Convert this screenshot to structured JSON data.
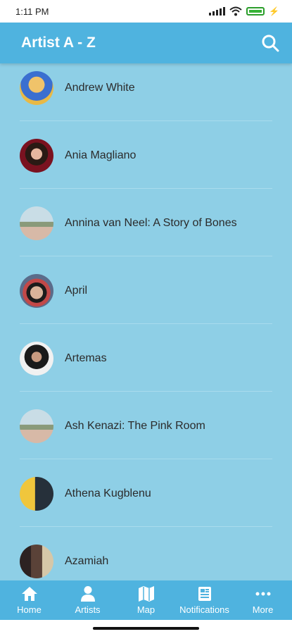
{
  "status_bar": {
    "time": "1:11 PM"
  },
  "app_bar": {
    "title": "Artist A - Z"
  },
  "artists": [
    {
      "name": "Andrew White"
    },
    {
      "name": "Ania Magliano"
    },
    {
      "name": "Annina van Neel: A Story of Bones"
    },
    {
      "name": "April"
    },
    {
      "name": "Artemas"
    },
    {
      "name": "Ash Kenazi: The Pink Room"
    },
    {
      "name": "Athena Kugblenu"
    },
    {
      "name": "Azamiah"
    }
  ],
  "bottom_nav": {
    "items": [
      {
        "label": "Home",
        "icon": "home-icon"
      },
      {
        "label": "Artists",
        "icon": "person-icon"
      },
      {
        "label": "Map",
        "icon": "map-icon"
      },
      {
        "label": "Notifications",
        "icon": "newspaper-icon"
      },
      {
        "label": "More",
        "icon": "more-dots-icon"
      }
    ]
  },
  "colors": {
    "app_bar": "#4fb3df",
    "background": "#8ecfe6",
    "divider": "#a9dced"
  }
}
